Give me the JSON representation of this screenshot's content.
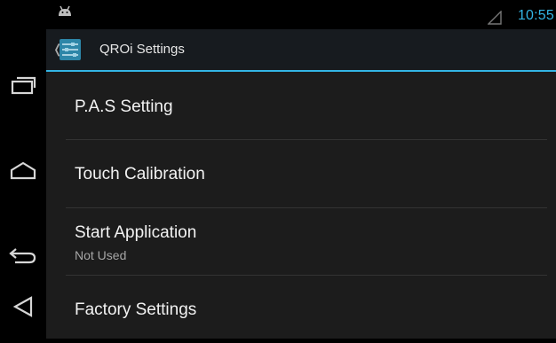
{
  "statusbar": {
    "time": "10:55",
    "time_color": "#33b5e5",
    "icons": [
      "android-debug-icon",
      "signal-icon"
    ]
  },
  "actionbar": {
    "title": "QROi Settings",
    "up_icon": "chevron-left-icon",
    "app_icon": "settings-sliders-icon",
    "accent_color": "#33b5e5"
  },
  "navbar": {
    "buttons": [
      "recent-apps-icon",
      "home-icon",
      "back-icon",
      "menu-icon"
    ]
  },
  "settings": {
    "items": [
      {
        "title": "P.A.S Setting",
        "summary": ""
      },
      {
        "title": "Touch Calibration",
        "summary": ""
      },
      {
        "title": "Start Application",
        "summary": "Not Used"
      },
      {
        "title": "Factory Settings",
        "summary": ""
      }
    ]
  }
}
